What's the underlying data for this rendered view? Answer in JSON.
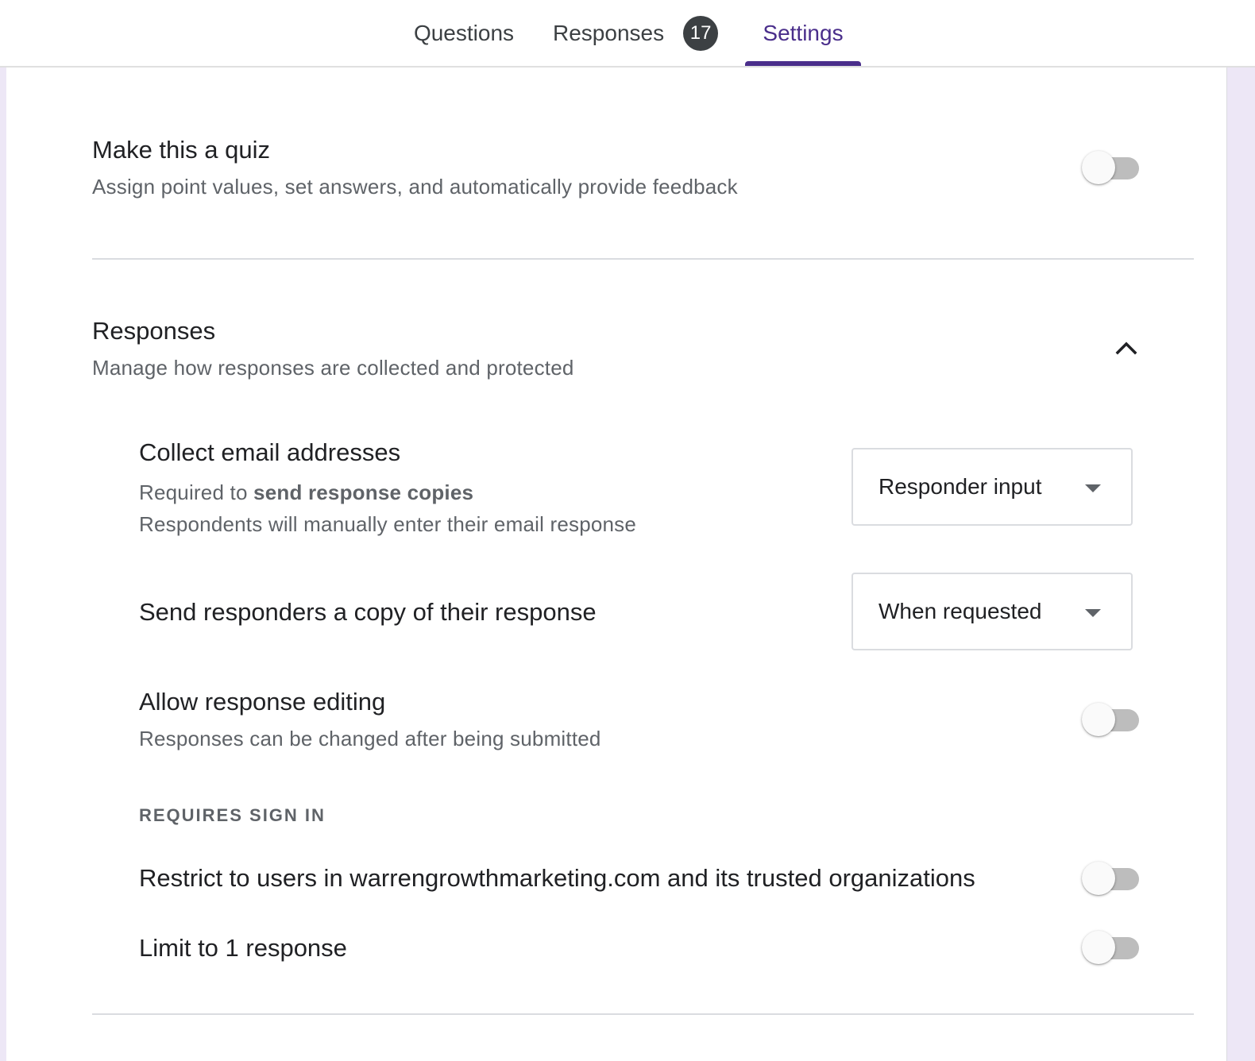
{
  "tabs": {
    "questions": "Questions",
    "responses": "Responses",
    "responses_count": "17",
    "settings": "Settings"
  },
  "quiz": {
    "title": "Make this a quiz",
    "description": "Assign point values, set answers, and automatically provide feedback",
    "enabled": false
  },
  "responses_section": {
    "title": "Responses",
    "description": "Manage how responses are collected and protected",
    "expanded": true,
    "collect_email": {
      "title": "Collect email addresses",
      "required_prefix": "Required to ",
      "required_bold": "send response copies",
      "description": "Respondents will manually enter their email response",
      "selected": "Responder input"
    },
    "send_copy": {
      "title": "Send responders a copy of their response",
      "selected": "When requested"
    },
    "allow_editing": {
      "title": "Allow response editing",
      "description": "Responses can be changed after being submitted",
      "enabled": false
    },
    "requires_sign_in_label": "REQUIRES SIGN IN",
    "restrict_users": {
      "title": "Restrict to users in warrengrowthmarketing.com and its trusted organizations",
      "enabled": false
    },
    "limit_response": {
      "title": "Limit to 1 response",
      "enabled": false
    }
  },
  "colors": {
    "accent": "#4a2e8b",
    "background_stripe": "#ede7f6",
    "toggle_off_track": "#bdbdbd",
    "badge": "#3c4043"
  }
}
